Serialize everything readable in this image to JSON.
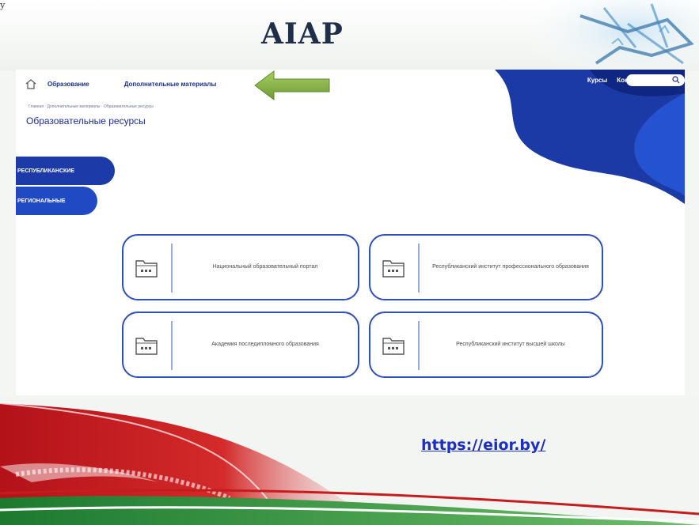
{
  "slide": {
    "title": "AIAP",
    "corner_text": "у"
  },
  "site": {
    "nav": {
      "home_icon": "home-icon",
      "education": "Образование",
      "extra_materials": "Дополнительные материалы",
      "courses": "Курсы",
      "contacts": "Контакты",
      "search_placeholder": ""
    },
    "breadcrumb": "Главная · Дополнительные материалы · Образовательные ресурсы",
    "page_title": "Образовательные ресурсы",
    "side_tabs": [
      {
        "label": "РЕСПУБЛИКАНСКИЕ"
      },
      {
        "label": "РЕГИОНАЛЬНЫЕ"
      }
    ],
    "cards": [
      {
        "label": "Национальный образовательный портал"
      },
      {
        "label": "Республиканский институт профессионального образования"
      },
      {
        "label": "Академия последипломного образования"
      },
      {
        "label": "Республиканский институт высшей школы"
      }
    ]
  },
  "link": "https://eior.by/",
  "colors": {
    "brand_blue": "#1d3ba8",
    "arrow_green": "#8cb84a",
    "link_blue": "#1b2fc0"
  }
}
